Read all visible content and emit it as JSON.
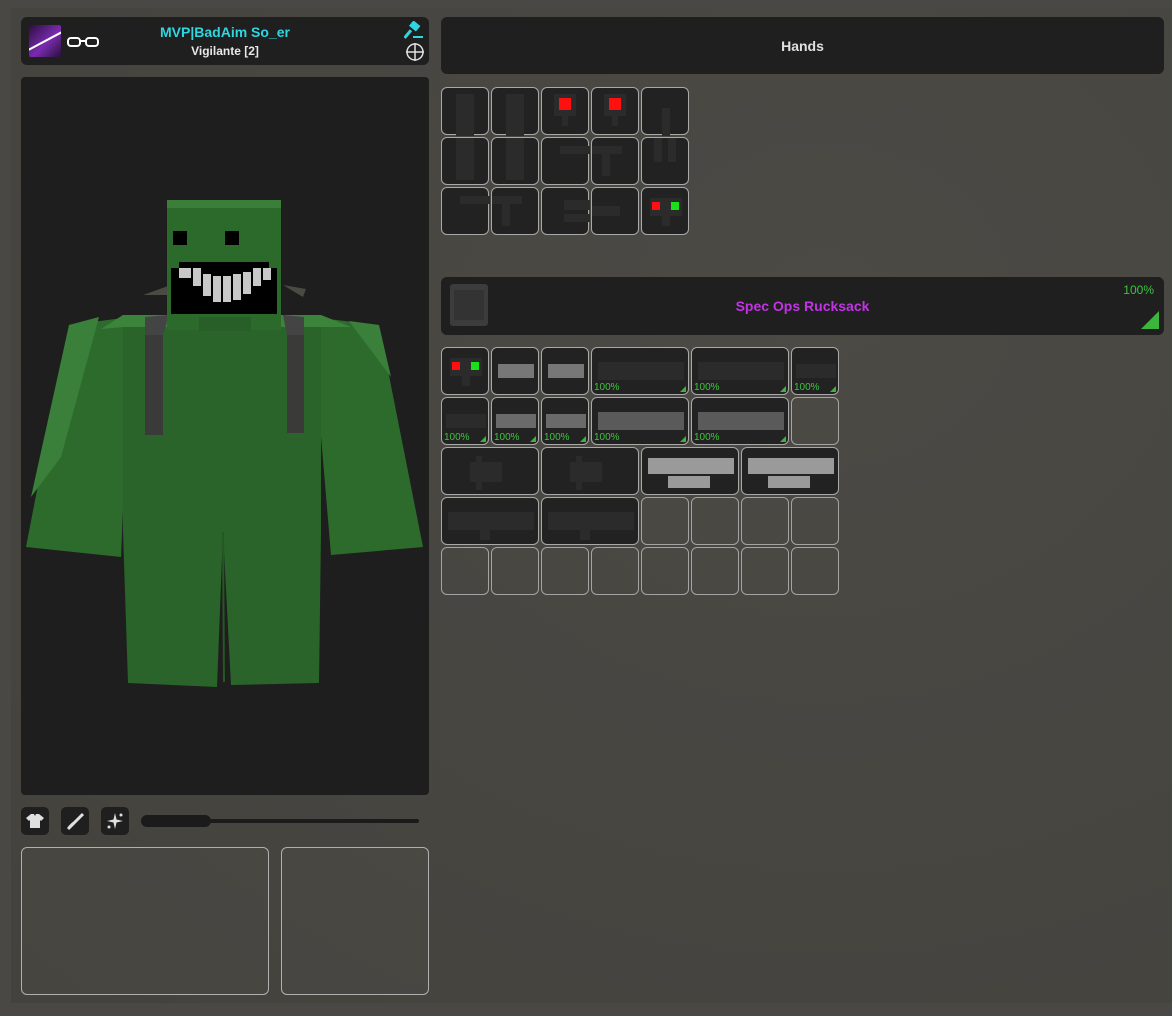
{
  "player": {
    "name": "MVP|BadAim So_er",
    "rank": "Vigilante [2]"
  },
  "icons": {
    "avatar": "avatar-icon",
    "glasses": "glasses-icon",
    "hammer": "hammer-icon",
    "crosshair": "crosshair-icon",
    "shirt": "shirt-icon",
    "weapon": "rifle-icon",
    "effects": "sparkle-icon"
  },
  "colors": {
    "name": "#2fd6e0",
    "backpack": "#c233e6",
    "durability": "#3ec33e",
    "green_dot": "#19e019",
    "red_dot": "#ff1010"
  },
  "hands": {
    "label": "Hands"
  },
  "backpack": {
    "name": "Spec Ops Rucksack",
    "durability": "100%"
  },
  "durability_labels": {
    "b1": "100%",
    "b2": "100%",
    "b3": "100%",
    "c1": "100%",
    "c2": "100%",
    "c3": "100%",
    "c4": "100%",
    "c5": "100%"
  }
}
